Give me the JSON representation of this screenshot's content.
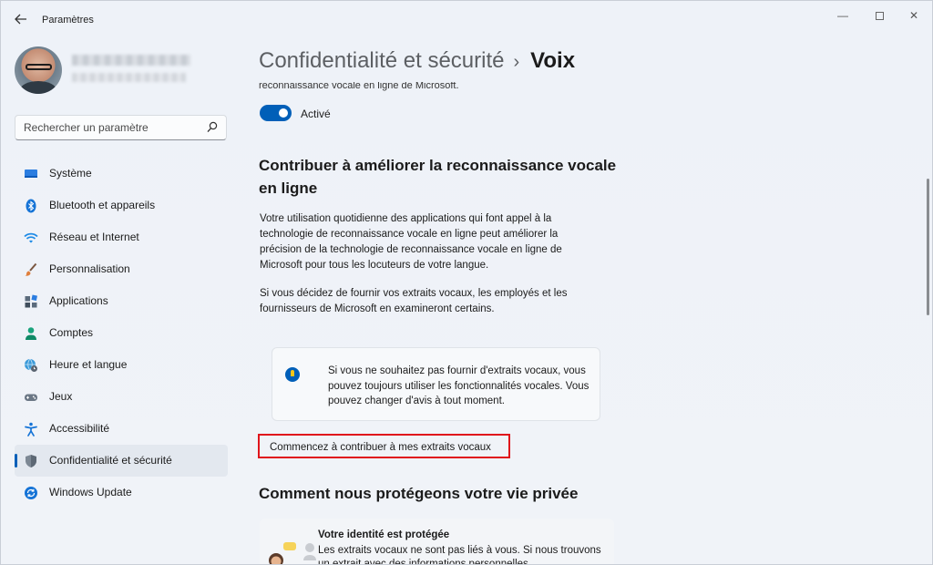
{
  "app": {
    "title": "Paramètres"
  },
  "window_controls": {
    "minimize": "—",
    "close": "✕"
  },
  "search": {
    "placeholder": "Rechercher un paramètre"
  },
  "sidebar": {
    "items": [
      {
        "label": "Système",
        "icon": "monitor-icon",
        "active": false
      },
      {
        "label": "Bluetooth et appareils",
        "icon": "bluetooth-icon",
        "active": false
      },
      {
        "label": "Réseau et Internet",
        "icon": "wifi-icon",
        "active": false
      },
      {
        "label": "Personnalisation",
        "icon": "brush-icon",
        "active": false
      },
      {
        "label": "Applications",
        "icon": "apps-icon",
        "active": false
      },
      {
        "label": "Comptes",
        "icon": "person-icon",
        "active": false
      },
      {
        "label": "Heure et langue",
        "icon": "globe-clock-icon",
        "active": false
      },
      {
        "label": "Jeux",
        "icon": "gamepad-icon",
        "active": false
      },
      {
        "label": "Accessibilité",
        "icon": "accessibility-icon",
        "active": false
      },
      {
        "label": "Confidentialité et sécurité",
        "icon": "shield-icon",
        "active": true
      },
      {
        "label": "Windows Update",
        "icon": "update-icon",
        "active": false
      }
    ]
  },
  "breadcrumb": {
    "parent": "Confidentialité et sécurité",
    "separator": "›",
    "current": "Voix"
  },
  "main": {
    "cut_text": "reconnaissance vocale en ligne de Microsoft.",
    "toggle": {
      "state": "on",
      "label": "Activé"
    },
    "section_title": "Contribuer à améliorer la reconnaissance vocale en ligne",
    "paragraph1": "Votre utilisation quotidienne des applications qui font appel à la technologie de reconnaissance vocale en ligne peut améliorer la précision de la technologie de reconnaissance vocale en ligne de Microsoft pour tous les locuteurs de votre langue.",
    "paragraph2": "Si vous décidez de fournir vos extraits vocaux, les employés et les fournisseurs de Microsoft en examineront certains.",
    "info_card": "Si vous ne souhaitez pas fournir d'extraits vocaux, vous pouvez toujours utiliser les fonctionnalités vocales. Vous pouvez changer d'avis à tout moment.",
    "contribute_button": "Commencez à contribuer à mes extraits vocaux",
    "section2_title": "Comment nous protégeons votre vie privée",
    "privacy_card": {
      "title": "Votre identité est protégée",
      "text": "Les extraits vocaux ne sont pas liés à vous.   Si nous trouvons un extrait avec des informations personnelles"
    }
  },
  "colors": {
    "accent": "#005fb8",
    "highlight_border": "#e0141b"
  }
}
